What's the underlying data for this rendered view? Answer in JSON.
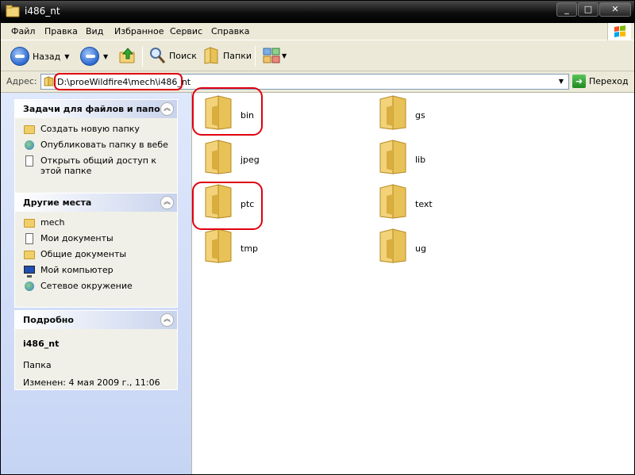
{
  "window": {
    "title": "i486_nt",
    "controls": [
      "_",
      "□",
      "✕"
    ]
  },
  "menu": [
    "Файл",
    "Правка",
    "Вид",
    "Избранное",
    "Сервис",
    "Справка"
  ],
  "toolbar": {
    "back_label": "Назад",
    "search_label": "Поиск",
    "folders_label": "Папки"
  },
  "address": {
    "label": "Адрес:",
    "value": "D:\\proeWildfire4\\mech\\i486_nt",
    "go_label": "Переход"
  },
  "tasks_panel": {
    "title": "Задачи для файлов и папок",
    "items": [
      {
        "icon": "new-folder-icon",
        "label": "Создать новую папку"
      },
      {
        "icon": "web-publish-icon",
        "label": "Опубликовать папку в вебе"
      },
      {
        "icon": "share-icon",
        "label": "Открыть общий доступ к этой папке"
      }
    ]
  },
  "places_panel": {
    "title": "Другие места",
    "items": [
      {
        "icon": "folder-icon",
        "label": "mech"
      },
      {
        "icon": "my-documents-icon",
        "label": "Мои документы"
      },
      {
        "icon": "shared-documents-icon",
        "label": "Общие документы"
      },
      {
        "icon": "my-computer-icon",
        "label": "Мой компьютер"
      },
      {
        "icon": "network-icon",
        "label": "Сетевое окружение"
      }
    ]
  },
  "details_panel": {
    "title": "Подробно",
    "name": "i486_nt",
    "type": "Папка",
    "modified": "Изменен: 4 мая 2009 г., 11:06"
  },
  "folders": [
    "bin",
    "gs",
    "jpeg",
    "lib",
    "ptc",
    "text",
    "tmp",
    "ug"
  ],
  "colors": {
    "highlight": "#e00010",
    "folder": "#f0cf6a",
    "left_pane": "#c6d4f4"
  }
}
